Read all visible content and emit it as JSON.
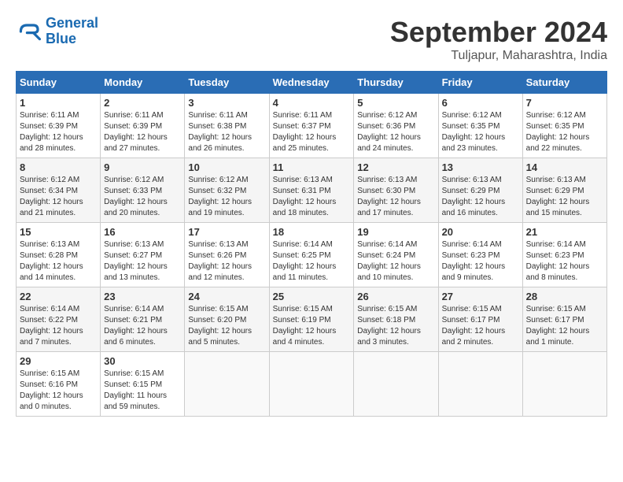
{
  "logo": {
    "line1": "General",
    "line2": "Blue"
  },
  "title": "September 2024",
  "subtitle": "Tuljapur, Maharashtra, India",
  "days_header": [
    "Sunday",
    "Monday",
    "Tuesday",
    "Wednesday",
    "Thursday",
    "Friday",
    "Saturday"
  ],
  "weeks": [
    [
      {
        "num": "1",
        "sunrise": "6:11 AM",
        "sunset": "6:39 PM",
        "daylight": "12 hours and 28 minutes."
      },
      {
        "num": "2",
        "sunrise": "6:11 AM",
        "sunset": "6:39 PM",
        "daylight": "12 hours and 27 minutes."
      },
      {
        "num": "3",
        "sunrise": "6:11 AM",
        "sunset": "6:38 PM",
        "daylight": "12 hours and 26 minutes."
      },
      {
        "num": "4",
        "sunrise": "6:11 AM",
        "sunset": "6:37 PM",
        "daylight": "12 hours and 25 minutes."
      },
      {
        "num": "5",
        "sunrise": "6:12 AM",
        "sunset": "6:36 PM",
        "daylight": "12 hours and 24 minutes."
      },
      {
        "num": "6",
        "sunrise": "6:12 AM",
        "sunset": "6:35 PM",
        "daylight": "12 hours and 23 minutes."
      },
      {
        "num": "7",
        "sunrise": "6:12 AM",
        "sunset": "6:35 PM",
        "daylight": "12 hours and 22 minutes."
      }
    ],
    [
      {
        "num": "8",
        "sunrise": "6:12 AM",
        "sunset": "6:34 PM",
        "daylight": "12 hours and 21 minutes."
      },
      {
        "num": "9",
        "sunrise": "6:12 AM",
        "sunset": "6:33 PM",
        "daylight": "12 hours and 20 minutes."
      },
      {
        "num": "10",
        "sunrise": "6:12 AM",
        "sunset": "6:32 PM",
        "daylight": "12 hours and 19 minutes."
      },
      {
        "num": "11",
        "sunrise": "6:13 AM",
        "sunset": "6:31 PM",
        "daylight": "12 hours and 18 minutes."
      },
      {
        "num": "12",
        "sunrise": "6:13 AM",
        "sunset": "6:30 PM",
        "daylight": "12 hours and 17 minutes."
      },
      {
        "num": "13",
        "sunrise": "6:13 AM",
        "sunset": "6:29 PM",
        "daylight": "12 hours and 16 minutes."
      },
      {
        "num": "14",
        "sunrise": "6:13 AM",
        "sunset": "6:29 PM",
        "daylight": "12 hours and 15 minutes."
      }
    ],
    [
      {
        "num": "15",
        "sunrise": "6:13 AM",
        "sunset": "6:28 PM",
        "daylight": "12 hours and 14 minutes."
      },
      {
        "num": "16",
        "sunrise": "6:13 AM",
        "sunset": "6:27 PM",
        "daylight": "12 hours and 13 minutes."
      },
      {
        "num": "17",
        "sunrise": "6:13 AM",
        "sunset": "6:26 PM",
        "daylight": "12 hours and 12 minutes."
      },
      {
        "num": "18",
        "sunrise": "6:14 AM",
        "sunset": "6:25 PM",
        "daylight": "12 hours and 11 minutes."
      },
      {
        "num": "19",
        "sunrise": "6:14 AM",
        "sunset": "6:24 PM",
        "daylight": "12 hours and 10 minutes."
      },
      {
        "num": "20",
        "sunrise": "6:14 AM",
        "sunset": "6:23 PM",
        "daylight": "12 hours and 9 minutes."
      },
      {
        "num": "21",
        "sunrise": "6:14 AM",
        "sunset": "6:23 PM",
        "daylight": "12 hours and 8 minutes."
      }
    ],
    [
      {
        "num": "22",
        "sunrise": "6:14 AM",
        "sunset": "6:22 PM",
        "daylight": "12 hours and 7 minutes."
      },
      {
        "num": "23",
        "sunrise": "6:14 AM",
        "sunset": "6:21 PM",
        "daylight": "12 hours and 6 minutes."
      },
      {
        "num": "24",
        "sunrise": "6:15 AM",
        "sunset": "6:20 PM",
        "daylight": "12 hours and 5 minutes."
      },
      {
        "num": "25",
        "sunrise": "6:15 AM",
        "sunset": "6:19 PM",
        "daylight": "12 hours and 4 minutes."
      },
      {
        "num": "26",
        "sunrise": "6:15 AM",
        "sunset": "6:18 PM",
        "daylight": "12 hours and 3 minutes."
      },
      {
        "num": "27",
        "sunrise": "6:15 AM",
        "sunset": "6:17 PM",
        "daylight": "12 hours and 2 minutes."
      },
      {
        "num": "28",
        "sunrise": "6:15 AM",
        "sunset": "6:17 PM",
        "daylight": "12 hours and 1 minute."
      }
    ],
    [
      {
        "num": "29",
        "sunrise": "6:15 AM",
        "sunset": "6:16 PM",
        "daylight": "12 hours and 0 minutes."
      },
      {
        "num": "30",
        "sunrise": "6:15 AM",
        "sunset": "6:15 PM",
        "daylight": "11 hours and 59 minutes."
      },
      null,
      null,
      null,
      null,
      null
    ]
  ]
}
